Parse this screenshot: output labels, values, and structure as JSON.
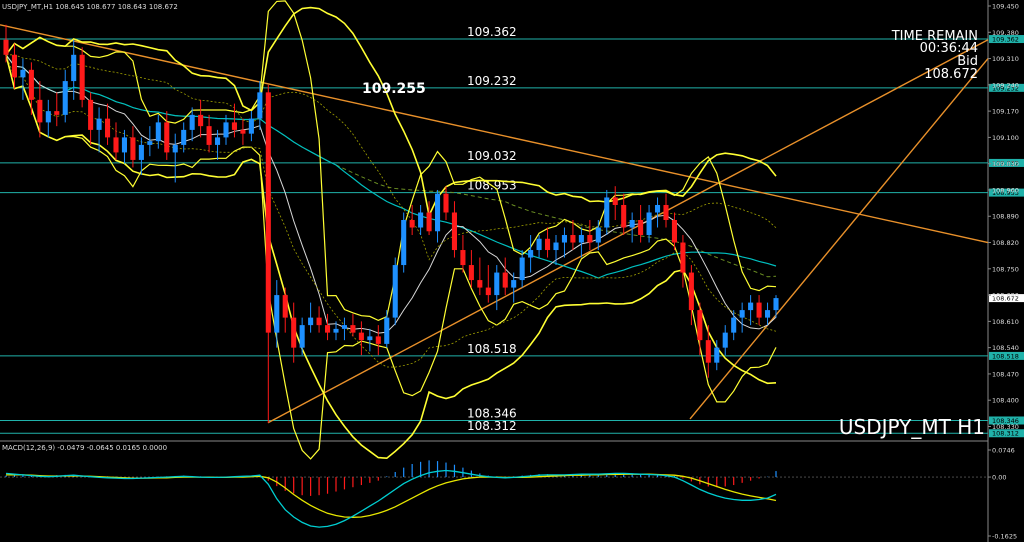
{
  "header": {
    "symbol_info": "USDJPY_MT,H1  108.645 108.677 108.643 108.672",
    "macd_info": "MACD(12,26,9) -0.0479 -0.0645 0.0165 0.0000"
  },
  "overlay": {
    "time_remain_label": "TIME REMAIN",
    "time_remain_value": "00:36:44",
    "bid_label": "Bid",
    "bid_value": "108.672",
    "watermark": "USDJPY_MT H1",
    "peak_label": "109.255"
  },
  "colors": {
    "background": "#000000",
    "bull": "#1e90ff",
    "bear": "#ff1a1a",
    "bollinger": "#ffff33",
    "level_line": "#20b2aa",
    "trendline": "#e8902a",
    "ma_white": "#d8d8d8",
    "ma_cyan": "#00bfbf",
    "ma_green_dash": "#6b8e23",
    "macd_signal": "#e6e600",
    "macd_main": "#00ced1"
  },
  "chart_data": {
    "type": "candlestick",
    "symbol": "USDJPY_MT",
    "timeframe": "H1",
    "ylim": [
      108.31,
      109.45
    ],
    "y_ticks": [
      "109.450",
      "109.380",
      "109.310",
      "109.240",
      "109.170",
      "109.100",
      "109.030",
      "108.960",
      "108.890",
      "108.820",
      "108.750",
      "108.680",
      "108.610",
      "108.540",
      "108.470",
      "108.400",
      "108.330"
    ],
    "levels": [
      {
        "value": 109.362,
        "label": "109.362",
        "axis_label": "109.362"
      },
      {
        "value": 109.232,
        "label": "109.232",
        "axis_label": "109.232"
      },
      {
        "value": 109.032,
        "label": "109.032",
        "axis_label": "109.032"
      },
      {
        "value": 108.953,
        "label": "108.953",
        "axis_label": "108.953"
      },
      {
        "value": 108.518,
        "label": "108.518",
        "axis_label": "108.518"
      },
      {
        "value": 108.346,
        "label": "108.346",
        "axis_label": "108.346"
      },
      {
        "value": 108.312,
        "label": "108.312",
        "axis_label": "108.312"
      }
    ],
    "current_price": {
      "value": 108.672,
      "label": "108.672"
    },
    "candles": [
      [
        109.36,
        109.4,
        109.3,
        109.32
      ],
      [
        109.32,
        109.35,
        109.23,
        109.26
      ],
      [
        109.26,
        109.31,
        109.2,
        109.28
      ],
      [
        109.28,
        109.3,
        109.16,
        109.2
      ],
      [
        109.2,
        109.25,
        109.1,
        109.14
      ],
      [
        109.14,
        109.2,
        109.1,
        109.17
      ],
      [
        109.17,
        109.22,
        109.13,
        109.16
      ],
      [
        109.16,
        109.28,
        109.14,
        109.25
      ],
      [
        109.25,
        109.36,
        109.2,
        109.32
      ],
      [
        109.32,
        109.34,
        109.18,
        109.2
      ],
      [
        109.2,
        109.22,
        109.08,
        109.12
      ],
      [
        109.12,
        109.18,
        109.06,
        109.15
      ],
      [
        109.15,
        109.19,
        109.08,
        109.1
      ],
      [
        109.1,
        109.14,
        109.04,
        109.06
      ],
      [
        109.06,
        109.12,
        109.03,
        109.1
      ],
      [
        109.1,
        109.13,
        109.02,
        109.04
      ],
      [
        109.04,
        109.1,
        109.0,
        109.08
      ],
      [
        109.08,
        109.13,
        109.05,
        109.09
      ],
      [
        109.09,
        109.16,
        109.07,
        109.14
      ],
      [
        109.14,
        109.17,
        109.04,
        109.06
      ],
      [
        109.06,
        109.11,
        108.98,
        109.08
      ],
      [
        109.08,
        109.14,
        109.06,
        109.12
      ],
      [
        109.12,
        109.18,
        109.09,
        109.16
      ],
      [
        109.16,
        109.2,
        109.1,
        109.13
      ],
      [
        109.13,
        109.16,
        109.06,
        109.08
      ],
      [
        109.08,
        109.12,
        109.04,
        109.1
      ],
      [
        109.1,
        109.16,
        109.08,
        109.14
      ],
      [
        109.14,
        109.19,
        109.1,
        109.12
      ],
      [
        109.12,
        109.15,
        109.08,
        109.11
      ],
      [
        109.11,
        109.17,
        109.09,
        109.15
      ],
      [
        109.15,
        109.25,
        109.12,
        109.22
      ],
      [
        109.22,
        109.24,
        108.34,
        108.58
      ],
      [
        108.58,
        108.72,
        108.54,
        108.68
      ],
      [
        108.68,
        108.7,
        108.58,
        108.62
      ],
      [
        108.62,
        108.66,
        108.5,
        108.54
      ],
      [
        108.54,
        108.62,
        108.52,
        108.6
      ],
      [
        108.6,
        108.66,
        108.58,
        108.62
      ],
      [
        108.62,
        108.65,
        108.58,
        108.6
      ],
      [
        108.6,
        108.63,
        108.56,
        108.58
      ],
      [
        108.58,
        108.61,
        108.56,
        108.59
      ],
      [
        108.59,
        108.62,
        108.56,
        108.6
      ],
      [
        108.6,
        108.63,
        108.57,
        108.58
      ],
      [
        108.58,
        108.61,
        108.52,
        108.56
      ],
      [
        108.56,
        108.59,
        108.53,
        108.57
      ],
      [
        108.57,
        108.6,
        108.52,
        108.55
      ],
      [
        108.55,
        108.64,
        108.54,
        108.62
      ],
      [
        108.62,
        108.78,
        108.6,
        108.76
      ],
      [
        108.76,
        108.9,
        108.74,
        108.88
      ],
      [
        108.88,
        108.92,
        108.84,
        108.86
      ],
      [
        108.86,
        108.92,
        108.84,
        108.9
      ],
      [
        108.9,
        108.93,
        108.84,
        108.85
      ],
      [
        108.85,
        108.96,
        108.82,
        108.95
      ],
      [
        108.95,
        108.97,
        108.88,
        108.9
      ],
      [
        108.9,
        108.93,
        108.78,
        108.8
      ],
      [
        108.8,
        108.84,
        108.74,
        108.76
      ],
      [
        108.76,
        108.8,
        108.7,
        108.72
      ],
      [
        108.72,
        108.78,
        108.68,
        108.7
      ],
      [
        108.7,
        108.76,
        108.66,
        108.68
      ],
      [
        108.68,
        108.76,
        108.64,
        108.74
      ],
      [
        108.74,
        108.78,
        108.68,
        108.7
      ],
      [
        108.7,
        108.74,
        108.66,
        108.72
      ],
      [
        108.72,
        108.8,
        108.7,
        108.78
      ],
      [
        108.78,
        108.84,
        108.74,
        108.8
      ],
      [
        108.8,
        108.84,
        108.78,
        108.83
      ],
      [
        108.83,
        108.86,
        108.78,
        108.8
      ],
      [
        108.8,
        108.84,
        108.76,
        108.82
      ],
      [
        108.82,
        108.86,
        108.78,
        108.84
      ],
      [
        108.84,
        108.88,
        108.8,
        108.82
      ],
      [
        108.82,
        108.86,
        108.78,
        108.84
      ],
      [
        108.84,
        108.88,
        108.8,
        108.82
      ],
      [
        108.82,
        108.88,
        108.8,
        108.86
      ],
      [
        108.86,
        108.96,
        108.84,
        108.94
      ],
      [
        108.94,
        108.97,
        108.88,
        108.92
      ],
      [
        108.92,
        108.95,
        108.84,
        108.86
      ],
      [
        108.86,
        108.9,
        108.82,
        108.88
      ],
      [
        108.88,
        108.92,
        108.82,
        108.84
      ],
      [
        108.84,
        108.92,
        108.82,
        108.9
      ],
      [
        108.9,
        108.94,
        108.86,
        108.92
      ],
      [
        108.92,
        108.95,
        108.86,
        108.88
      ],
      [
        108.88,
        108.9,
        108.8,
        108.82
      ],
      [
        108.82,
        108.84,
        108.7,
        108.74
      ],
      [
        108.74,
        108.76,
        108.6,
        108.64
      ],
      [
        108.64,
        108.66,
        108.52,
        108.56
      ],
      [
        108.56,
        108.6,
        108.46,
        108.5
      ],
      [
        108.5,
        108.56,
        108.48,
        108.54
      ],
      [
        108.54,
        108.6,
        108.52,
        108.58
      ],
      [
        108.58,
        108.64,
        108.56,
        108.62
      ],
      [
        108.62,
        108.66,
        108.58,
        108.64
      ],
      [
        108.64,
        108.68,
        108.6,
        108.66
      ],
      [
        108.66,
        108.68,
        108.6,
        108.62
      ],
      [
        108.62,
        108.66,
        108.6,
        108.64
      ],
      [
        108.64,
        108.68,
        108.62,
        108.672
      ]
    ],
    "macd": {
      "ylim": [
        -0.1625,
        0.0746
      ],
      "y_ticks": [
        "0.0746",
        "0.00",
        "-0.1625"
      ],
      "histogram": [
        0.004,
        0.006,
        0.005,
        0.004,
        0.003,
        0.004,
        0.005,
        0.006,
        0.005,
        0.004,
        0.003,
        0.002,
        0.002,
        0.001,
        0.0,
        -0.001,
        -0.002,
        -0.001,
        0.001,
        0.002,
        0.003,
        0.004,
        0.003,
        0.002,
        0.001,
        0.0,
        0.001,
        0.002,
        0.003,
        0.004,
        0.005,
        -0.01,
        -0.025,
        -0.038,
        -0.045,
        -0.05,
        -0.052,
        -0.05,
        -0.046,
        -0.04,
        -0.034,
        -0.028,
        -0.022,
        -0.016,
        -0.01,
        0.002,
        0.014,
        0.026,
        0.036,
        0.042,
        0.046,
        0.044,
        0.04,
        0.034,
        0.026,
        0.018,
        0.01,
        0.004,
        0.002,
        0.001,
        0.002,
        0.004,
        0.006,
        0.008,
        0.008,
        0.007,
        0.006,
        0.007,
        0.008,
        0.008,
        0.007,
        0.009,
        0.01,
        0.008,
        0.007,
        0.006,
        0.006,
        0.007,
        0.006,
        0.003,
        -0.004,
        -0.012,
        -0.02,
        -0.026,
        -0.028,
        -0.026,
        -0.022,
        -0.016,
        -0.01,
        -0.004,
        0.001,
        0.0165
      ],
      "main": [
        0.01,
        0.008,
        0.006,
        0.004,
        0.002,
        0.001,
        0.002,
        0.004,
        0.005,
        0.003,
        0.001,
        -0.001,
        -0.002,
        -0.003,
        -0.004,
        -0.004,
        -0.003,
        -0.002,
        -0.001,
        0.0,
        0.001,
        0.002,
        0.001,
        0.0,
        -0.001,
        -0.001,
        0.0,
        0.001,
        0.002,
        0.003,
        0.005,
        -0.02,
        -0.06,
        -0.09,
        -0.11,
        -0.125,
        -0.135,
        -0.138,
        -0.136,
        -0.13,
        -0.12,
        -0.108,
        -0.094,
        -0.08,
        -0.066,
        -0.05,
        -0.034,
        -0.018,
        -0.006,
        0.004,
        0.012,
        0.016,
        0.018,
        0.016,
        0.012,
        0.008,
        0.004,
        0.001,
        -0.001,
        -0.002,
        -0.001,
        0.001,
        0.003,
        0.005,
        0.006,
        0.006,
        0.006,
        0.007,
        0.008,
        0.008,
        0.008,
        0.009,
        0.01,
        0.01,
        0.009,
        0.008,
        0.007,
        0.006,
        0.004,
        0.0,
        -0.01,
        -0.022,
        -0.034,
        -0.044,
        -0.052,
        -0.058,
        -0.062,
        -0.064,
        -0.064,
        -0.062,
        -0.058,
        -0.0479
      ],
      "signal": [
        0.006,
        0.006,
        0.006,
        0.005,
        0.004,
        0.003,
        0.003,
        0.003,
        0.003,
        0.003,
        0.002,
        0.001,
        0.0,
        -0.001,
        -0.002,
        -0.003,
        -0.003,
        -0.003,
        -0.002,
        -0.002,
        -0.001,
        0.0,
        0.0,
        0.0,
        0.0,
        -0.001,
        -0.001,
        0.0,
        0.0,
        0.001,
        0.002,
        -0.002,
        -0.014,
        -0.03,
        -0.048,
        -0.064,
        -0.078,
        -0.09,
        -0.1,
        -0.106,
        -0.11,
        -0.111,
        -0.11,
        -0.106,
        -0.1,
        -0.092,
        -0.082,
        -0.07,
        -0.058,
        -0.046,
        -0.034,
        -0.024,
        -0.016,
        -0.01,
        -0.005,
        -0.002,
        0.0,
        0.0,
        0.0,
        -0.001,
        -0.001,
        -0.001,
        0.0,
        0.001,
        0.002,
        0.003,
        0.004,
        0.005,
        0.005,
        0.006,
        0.006,
        0.007,
        0.007,
        0.008,
        0.008,
        0.008,
        0.008,
        0.007,
        0.006,
        0.005,
        0.002,
        -0.003,
        -0.01,
        -0.018,
        -0.026,
        -0.034,
        -0.041,
        -0.047,
        -0.052,
        -0.056,
        -0.06,
        -0.0645
      ]
    }
  }
}
